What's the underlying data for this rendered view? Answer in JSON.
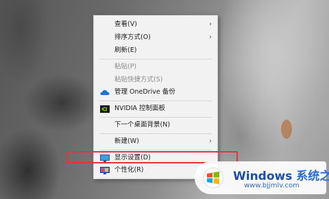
{
  "menu": {
    "items": [
      {
        "label": "查看(V)",
        "submenu": true,
        "disabled": false
      },
      {
        "label": "排序方式(O)",
        "submenu": true,
        "disabled": false
      },
      {
        "label": "刷新(E)",
        "submenu": false,
        "disabled": false
      },
      {
        "label": "粘贴(P)",
        "submenu": false,
        "disabled": true
      },
      {
        "label": "粘贴快捷方式(S)",
        "submenu": false,
        "disabled": true
      },
      {
        "label": "管理 OneDrive 备份",
        "submenu": false,
        "disabled": false,
        "icon": "onedrive-cloud-icon"
      },
      {
        "label": "NVIDIA 控制面板",
        "submenu": false,
        "disabled": false,
        "icon": "nvidia-icon"
      },
      {
        "label": "下一个桌面背景(N)",
        "submenu": false,
        "disabled": false
      },
      {
        "label": "新建(W)",
        "submenu": true,
        "disabled": false
      },
      {
        "label": "显示设置(D)",
        "submenu": false,
        "disabled": false,
        "icon": "display-settings-icon",
        "highlighted": true
      },
      {
        "label": "个性化(R)",
        "submenu": false,
        "disabled": false,
        "icon": "personalize-icon"
      }
    ],
    "submenu_arrow": "›"
  },
  "watermark": {
    "title_main": "Windows",
    "title_sub": "系统之家",
    "url": "www.bjjmlv.com"
  },
  "colors": {
    "highlight_border": "#e8323a",
    "menu_bg": "#f2f2f2",
    "watermark_blue": "#1b4fa8"
  }
}
